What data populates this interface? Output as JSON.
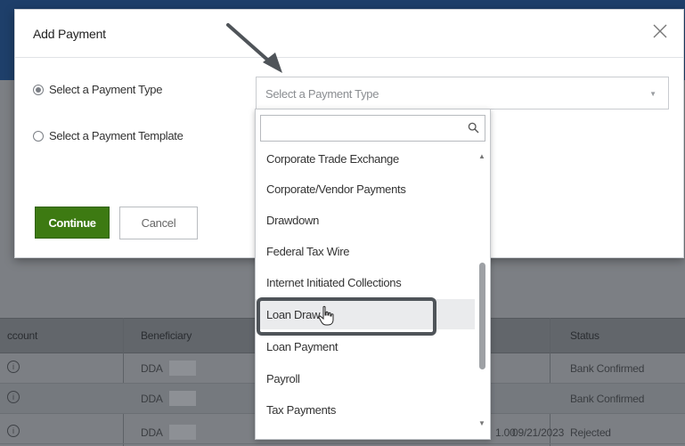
{
  "modal": {
    "title": "Add Payment",
    "radio_payment_type_label": "Select a Payment Type",
    "radio_payment_template_label": "Select a Payment Template",
    "select_placeholder": "Select a Payment Type",
    "continue_label": "Continue",
    "cancel_label": "Cancel"
  },
  "dropdown": {
    "search_value": "",
    "items": [
      "Corporate Trade Exchange",
      "Corporate/Vendor Payments",
      "Drawdown",
      "Federal Tax Wire",
      "Internet Initiated Collections",
      "Loan Draw",
      "Loan Payment",
      "Payroll",
      "Tax Payments"
    ],
    "hovered_item": "Loan Draw"
  },
  "background_table": {
    "headers": [
      "ccount",
      "Beneficiary",
      "Status"
    ],
    "rows": [
      {
        "beneficiary": "DDA",
        "amount": "",
        "date": "",
        "status": "Bank Confirmed"
      },
      {
        "beneficiary": "DDA",
        "amount": "",
        "date": "",
        "status": "Bank Confirmed"
      },
      {
        "beneficiary": "DDA",
        "amount": "1.00",
        "date": "09/21/2023",
        "status": "Rejected"
      }
    ]
  },
  "colors": {
    "continue_button": "#3d7a12",
    "overlay": "#7c7f84",
    "highlight_box": "#4f5459",
    "annotation_arrow": "#4f5459"
  },
  "icons": {
    "close": "close-icon",
    "search": "search-icon",
    "select_arrow": "chevron-down-icon",
    "info": "info-icon",
    "cursor": "hand-pointer-icon"
  }
}
